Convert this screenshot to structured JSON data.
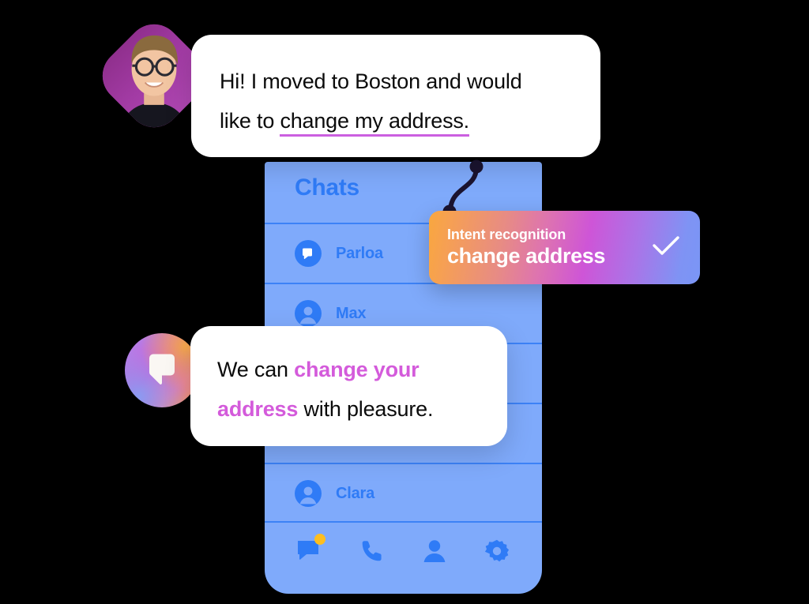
{
  "phone": {
    "title": "Chats",
    "chats": [
      {
        "name": "Parloa",
        "avatar_icon": "parloa-logo-icon"
      },
      {
        "name": "Max",
        "avatar_icon": "person-avatar-icon"
      },
      {
        "name": "",
        "avatar_icon": "person-avatar-icon"
      },
      {
        "name": "",
        "avatar_icon": "person-avatar-icon"
      },
      {
        "name": "Clara",
        "avatar_icon": "person-avatar-icon"
      }
    ],
    "nav": [
      {
        "name": "chats-tab",
        "icon": "chat-bubble-icon",
        "badge": true
      },
      {
        "name": "calls-tab",
        "icon": "phone-icon",
        "badge": false
      },
      {
        "name": "contacts-tab",
        "icon": "person-icon",
        "badge": false
      },
      {
        "name": "settings-tab",
        "icon": "gear-icon",
        "badge": false
      }
    ]
  },
  "user_message": {
    "line1": "Hi! I moved to Boston and would",
    "line2_prefix": "like to ",
    "line2_highlight": "change my address.",
    "avatar_icon": "user-photo-avatar"
  },
  "bot_message": {
    "prefix": "We can ",
    "highlight1": "change your",
    "highlight2": "address",
    "suffix": " with pleasure.",
    "avatar_icon": "parloa-logo-icon"
  },
  "intent_badge": {
    "label": "Intent recognition",
    "value": "change address",
    "check_icon": "check-icon"
  },
  "colors": {
    "phone_bg": "#7FAAFB",
    "phone_accent": "#2F7BF6",
    "divider": "#3C82F6",
    "highlight_pink": "#D45BDB",
    "underline_purple": "#CB5FE0",
    "badge_gradient_start": "#F9A73E",
    "badge_gradient_mid": "#CE55D7",
    "badge_gradient_end": "#7A96F6",
    "notification_yellow": "#FDBE1F",
    "connector": "#1B1430",
    "bubble_bg": "#FFFFFF",
    "page_bg": "#000000"
  }
}
